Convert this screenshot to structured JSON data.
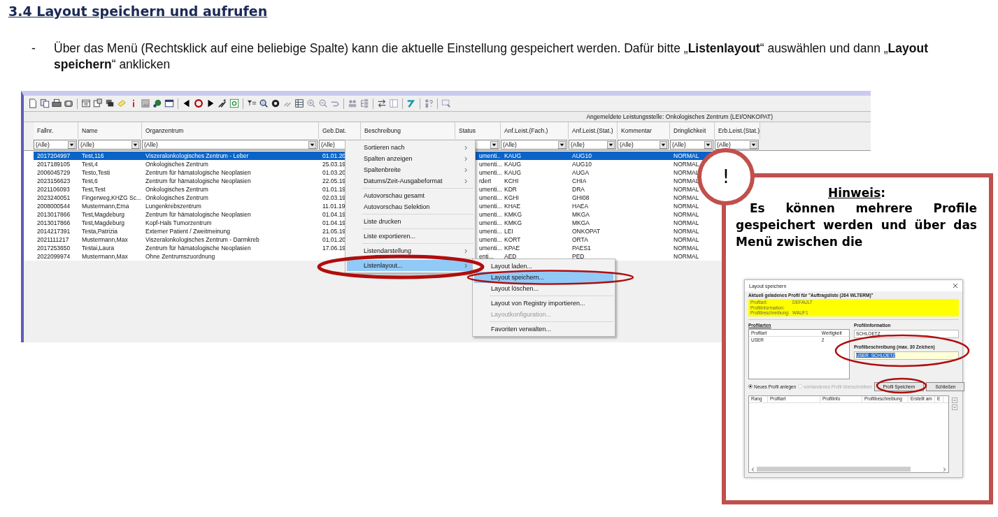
{
  "heading": "3.4 Layout speichern und aufrufen",
  "instructions": [
    {
      "bullet": "-",
      "text": "Über das Menü (Rechtsklick auf eine beliebige Spalte) kann die aktuelle Einstellung gespeichert werden. Dafür bitte „**Listenlayout**“ auswählen und dann „**Layout speichern**“ anklicken"
    }
  ],
  "screenshot": {
    "info_bar": "Angemeldete Leistungsstelle: Onkologisches Zentrum (LEI/ONKOPAT)",
    "table": {
      "columns": [
        {
          "label": "Fallnr.",
          "filter": "(Alle)"
        },
        {
          "label": "Name",
          "filter": "(Alle)"
        },
        {
          "label": "Organzentrum",
          "filter": "(Alle)"
        },
        {
          "label": "Geb.Dat.",
          "filter": "(Alle)"
        },
        {
          "label": "Beschreibung"
        },
        {
          "label": "Status"
        },
        {
          "label": "Anf.Leist.(Fach.)",
          "filter": "(Alle)"
        },
        {
          "label": "Anf.Leist.(Stat.)",
          "filter": "(Alle)"
        },
        {
          "label": "Kommentar",
          "filter": "(Alle)"
        },
        {
          "label": "Dringlichkeit",
          "filter": "(Alle)"
        },
        {
          "label": "Erb.Leist.(Stat.)",
          "filter": "(Alle)"
        }
      ],
      "rows": [
        {
          "selected": true,
          "fallnr": "2017204997",
          "name": "Test,116",
          "organzentrum": "Viszeralonkologisches Zentrum - Leber",
          "geb_dat": "01.01.20",
          "status": "umenti...",
          "anf_fach": "KAUG",
          "anf_stat": "AUG10",
          "dringlichkeit": "NORMAL"
        },
        {
          "selected": false,
          "fallnr": "2017189105",
          "name": "Test,4",
          "organzentrum": "Onkologisches Zentrum",
          "geb_dat": "25.03.19",
          "status": "umenti...",
          "anf_fach": "KAUG",
          "anf_stat": "AUG10",
          "dringlichkeit": "NORMAL"
        },
        {
          "selected": false,
          "fallnr": "2006045729",
          "name": "Testo,Testi",
          "organzentrum": "Zentrum für hämatologische Neoplasien",
          "geb_dat": "01.03.20",
          "status": "umenti...",
          "anf_fach": "KAUG",
          "anf_stat": "AUGA",
          "dringlichkeit": "NORMAL"
        },
        {
          "selected": false,
          "fallnr": "2023156623",
          "name": "Test,6",
          "organzentrum": "Zentrum für hämatologische Neoplasien",
          "geb_dat": "22.05.19",
          "status": "rdert",
          "anf_fach": "KCHI",
          "anf_stat": "CHIA",
          "dringlichkeit": "NORMAL"
        },
        {
          "selected": false,
          "fallnr": "2021106093",
          "name": "Test,Test",
          "organzentrum": "Onkologisches Zentrum",
          "geb_dat": "01.01.19",
          "status": "umenti...",
          "anf_fach": "KDR",
          "anf_stat": "DRA",
          "dringlichkeit": "NORMAL"
        },
        {
          "selected": false,
          "fallnr": "2023240051",
          "name": "Fingerweg,KHZG Sc...",
          "organzentrum": "Onkologisches Zentrum",
          "geb_dat": "02.03.19",
          "status": "umenti...",
          "anf_fach": "KGHI",
          "anf_stat": "GHI08",
          "dringlichkeit": "NORMAL"
        },
        {
          "selected": false,
          "fallnr": "2008000544",
          "name": "Mustermann,Erna",
          "organzentrum": "Lungenkrebszentrum",
          "geb_dat": "11.01.19",
          "status": "umenti...",
          "anf_fach": "KHAE",
          "anf_stat": "HAEA",
          "dringlichkeit": "NORMAL"
        },
        {
          "selected": false,
          "fallnr": "2013017866",
          "name": "Test,Magdeburg",
          "organzentrum": "Zentrum für hämatologische Neoplasien",
          "geb_dat": "01.04.19",
          "status": "umenti...",
          "anf_fach": "KMKG",
          "anf_stat": "MKGA",
          "dringlichkeit": "NORMAL"
        },
        {
          "selected": false,
          "fallnr": "2013017866",
          "name": "Test,Magdeburg",
          "organzentrum": "Kopf-Hals Tumorzentrum",
          "geb_dat": "01.04.19",
          "status": "umenti...",
          "anf_fach": "KMKG",
          "anf_stat": "MKGA",
          "dringlichkeit": "NORMAL"
        },
        {
          "selected": false,
          "fallnr": "2014217391",
          "name": "Testa,Patrizia",
          "organzentrum": "Externer Patient / Zweitmeinung",
          "geb_dat": "21.05.19",
          "status": "umenti...",
          "anf_fach": "LEI",
          "anf_stat": "ONKOPAT",
          "dringlichkeit": "NORMAL"
        },
        {
          "selected": false,
          "fallnr": "2021111217",
          "name": "Mustermann,Max",
          "organzentrum": "Viszeralonkologisches Zentrum - Darmkreb",
          "geb_dat": "01.01.20",
          "status": "umenti...",
          "anf_fach": "KORT",
          "anf_stat": "ORTA",
          "dringlichkeit": "NORMAL"
        },
        {
          "selected": false,
          "fallnr": "2017253650",
          "name": "Testai,Laura",
          "organzentrum": "Zentrum für hämatologische Neoplasien",
          "geb_dat": "17.06.19",
          "status": "umenti...",
          "anf_fach": "KPAE",
          "anf_stat": "PAES1",
          "dringlichkeit": "NORMAL"
        },
        {
          "selected": false,
          "fallnr": "2022099974",
          "name": "Mustermann,Max",
          "organzentrum": "Ohne Zentrumszuordnung",
          "status": "enti...",
          "anf_fach": "AED",
          "anf_stat": "PED",
          "dringlichkeit": "NORMAL"
        }
      ]
    },
    "context_menu": {
      "items": [
        {
          "kind": "item",
          "label": "Sortieren nach",
          "has_submenu": true,
          "selected": false
        },
        {
          "kind": "item",
          "label": "Spalten anzeigen",
          "has_submenu": true,
          "selected": false
        },
        {
          "kind": "item",
          "label": "Spaltenbreite",
          "has_submenu": true,
          "selected": false
        },
        {
          "kind": "item",
          "label": "Datums/Zeit-Ausgabeformat",
          "has_submenu": true,
          "selected": false
        },
        {
          "kind": "separator"
        },
        {
          "kind": "item",
          "label": "Autovorschau gesamt",
          "has_submenu": false,
          "selected": false
        },
        {
          "kind": "item",
          "label": "Autovorschau Selektion",
          "has_submenu": false,
          "selected": false
        },
        {
          "kind": "separator"
        },
        {
          "kind": "item",
          "label": "Liste drucken",
          "has_submenu": false,
          "selected": false
        },
        {
          "kind": "separator"
        },
        {
          "kind": "item",
          "label": "Liste exportieren...",
          "has_submenu": false,
          "selected": false
        },
        {
          "kind": "separator"
        },
        {
          "kind": "item",
          "label": "Listendarstellung",
          "has_submenu": true,
          "selected": false
        },
        {
          "kind": "separator"
        },
        {
          "kind": "item",
          "label": "Listenlayout...",
          "has_submenu": true,
          "selected": true
        }
      ]
    },
    "submenu": {
      "items": [
        {
          "kind": "item",
          "label": "Layout laden...",
          "selected": false,
          "disabled": false
        },
        {
          "kind": "item",
          "label": "Layout speichern...",
          "selected": true,
          "disabled": false
        },
        {
          "kind": "item",
          "label": "Layout löschen...",
          "selected": false,
          "disabled": false
        },
        {
          "kind": "separator"
        },
        {
          "kind": "item",
          "label": "Layout von Registry importieren...",
          "selected": false,
          "disabled": false
        },
        {
          "kind": "item",
          "label": "Layoutkonfiguration...",
          "selected": false,
          "disabled": true
        },
        {
          "kind": "separator"
        },
        {
          "kind": "item",
          "label": "Favoriten verwalten...",
          "selected": false,
          "disabled": false
        }
      ]
    }
  },
  "callout": {
    "badge": "!",
    "title": "Hinweis:",
    "text": "Es können mehrere Profile gespeichert werden und über das Menü zwischen die",
    "dialog": {
      "title": "Layout speichern",
      "loaded_heading": "Aktuell geladenes Profil für \"Auftragsliste (264 WLTERM)\"",
      "loaded_profile": [
        {
          "label": "Profilart:",
          "value": "DEFAULT"
        },
        {
          "label": "Profilinformation:"
        },
        {
          "label": "Profilbeschreibung:",
          "value": "WAUF1"
        }
      ],
      "profile_types": {
        "title": "Profilarten",
        "columns": [
          "Profilart",
          "Wertigkeit"
        ],
        "rows": [
          [
            "USER",
            "2"
          ]
        ]
      },
      "profile_info": {
        "title": "Profilinformation",
        "value": "SCHLOETZ",
        "description_label": "Profilbeschreibung (max. 30 Zeichen)",
        "description_value": "USER_SCHLOETZ"
      },
      "options": [
        {
          "label": "Neues Profil anlegen",
          "selected": true,
          "disabled": false
        },
        {
          "label": "vorhandenes Profil überschreiben",
          "selected": false,
          "disabled": true
        }
      ],
      "buttons": [
        "Profil Speichern",
        "Schließen"
      ],
      "profiles_table": {
        "columns": [
          "Rang",
          "Profilart",
          "Profilinfo",
          "Profilbeschreibung",
          "Erstellt am",
          "E"
        ]
      }
    }
  }
}
